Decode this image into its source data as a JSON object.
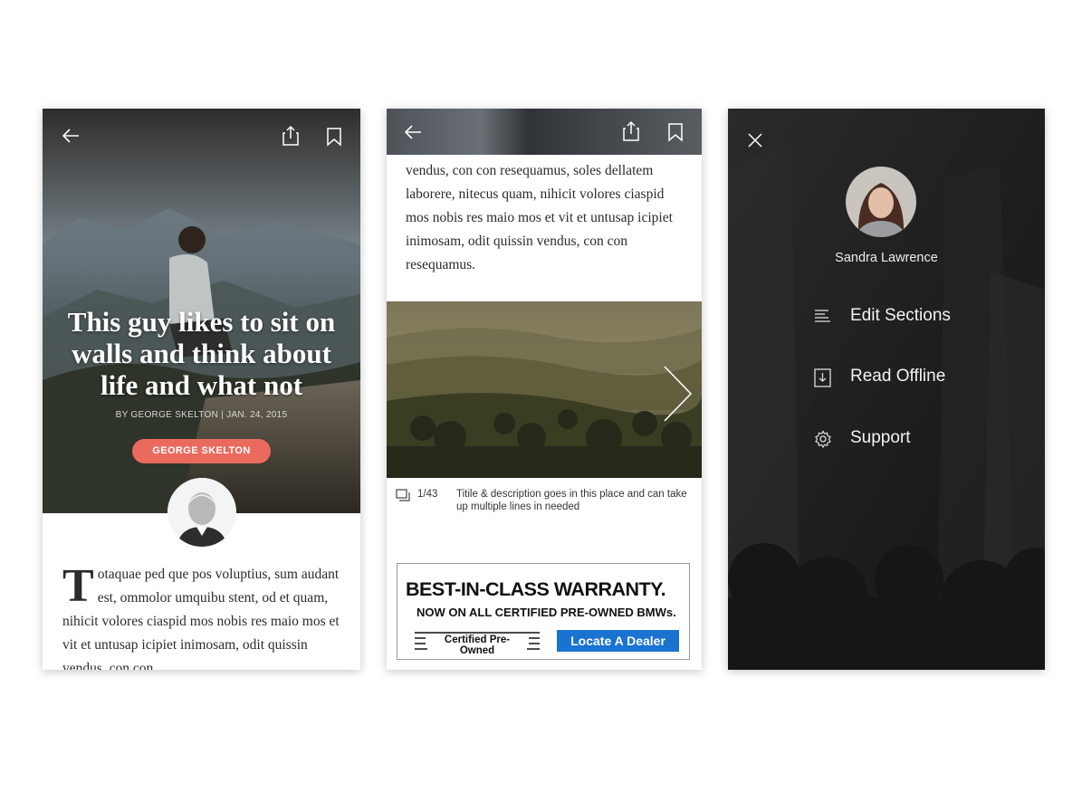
{
  "article_screen": {
    "title": "This guy likes to sit on walls and think about life and what not",
    "byline": "BY GEORGE SKELTON | JAN. 24, 2015",
    "author_button": "GEORGE SKELTON",
    "drop_cap": "T",
    "body": "otaquae ped que pos voluptius, sum audant est, ommolor umquibu stent, od et quam, nihicit volores ciaspid mos nobis res maio mos et vit et untusap icipiet inimosam, odit quissin vendus, con con"
  },
  "gallery_screen": {
    "body": "vendus, con con resequamus, soles dellatem laborere, nitecus quam, nihicit volores ciaspid mos nobis res maio mos et vit et untusap icipiet inimosam, odit quissin vendus, con con resequamus.",
    "counter": "1/43",
    "caption": "Titile & description goes in this place and can take up multiple lines in needed",
    "ad": {
      "headline": "BEST-IN-CLASS WARRANTY.",
      "subhead": "NOW ON ALL CERTIFIED PRE-OWNED BMWs.",
      "badge": "Certified Pre-Owned",
      "cta": "Locate A Dealer"
    }
  },
  "menu_screen": {
    "user_name": "Sandra Lawrence",
    "items": [
      {
        "label": "Edit Sections",
        "icon": "lines-icon"
      },
      {
        "label": "Read Offline",
        "icon": "download-icon"
      },
      {
        "label": "Support",
        "icon": "gear-icon"
      }
    ]
  },
  "colors": {
    "accent": "#ea6b5e",
    "cta_blue": "#1a73d1"
  }
}
